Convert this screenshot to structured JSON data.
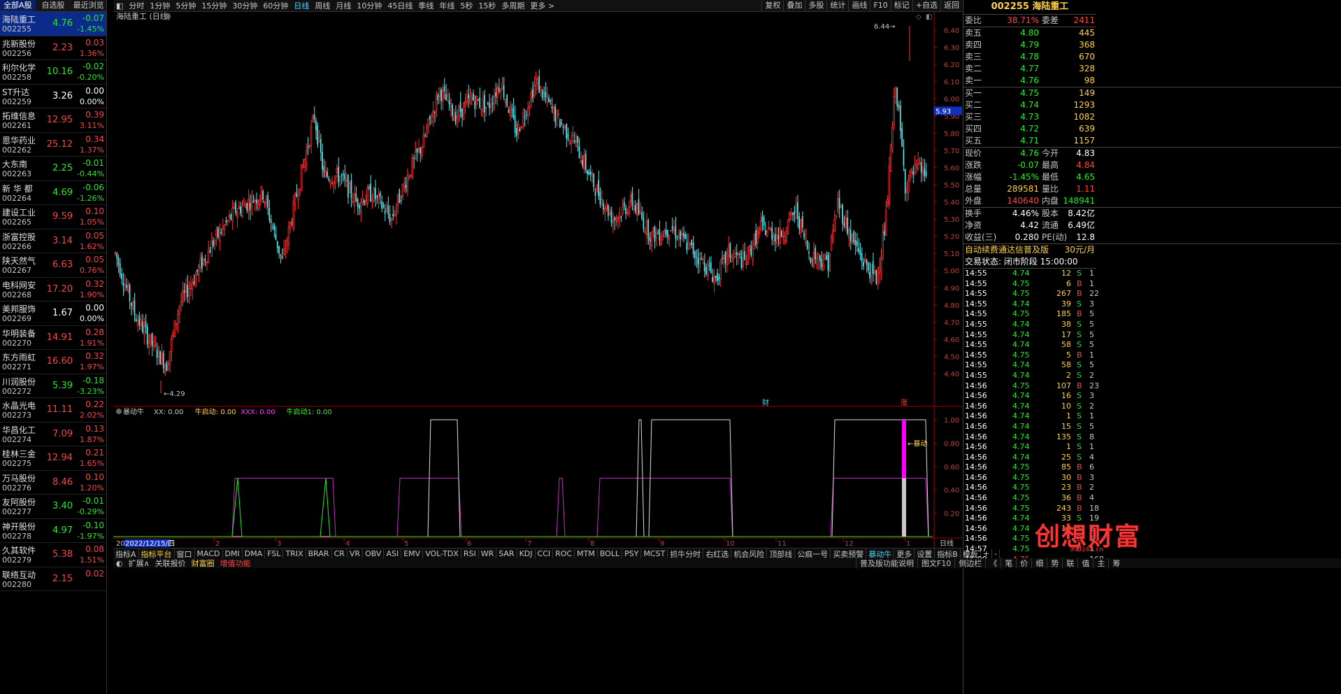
{
  "list_tabs": [
    "全部A股",
    "自选股",
    "最近浏览"
  ],
  "stocks": [
    {
      "name": "海陆重工",
      "code": "002255",
      "price": "4.76",
      "chg": "-0.07",
      "pct": "-1.45%",
      "dir": "dn"
    },
    {
      "name": "兆新股份",
      "code": "002256",
      "price": "2.23",
      "chg": "0.03",
      "pct": "1.36%",
      "dir": "up"
    },
    {
      "name": "利尔化学",
      "code": "002258",
      "price": "10.16",
      "chg": "-0.02",
      "pct": "-0.20%",
      "dir": "dn"
    },
    {
      "name": "ST升达",
      "code": "002259",
      "price": "3.26",
      "chg": "0.00",
      "pct": "0.00%",
      "dir": "fl"
    },
    {
      "name": "拓维信息",
      "code": "002261",
      "price": "12.95",
      "chg": "0.39",
      "pct": "3.11%",
      "dir": "up"
    },
    {
      "name": "恩华药业",
      "code": "002262",
      "price": "25.12",
      "chg": "0.34",
      "pct": "1.37%",
      "dir": "up"
    },
    {
      "name": "大东南",
      "code": "002263",
      "price": "2.25",
      "chg": "-0.01",
      "pct": "-0.44%",
      "dir": "dn"
    },
    {
      "name": "新 华 都",
      "code": "002264",
      "price": "4.69",
      "chg": "-0.06",
      "pct": "-1.26%",
      "dir": "dn"
    },
    {
      "name": "建设工业",
      "code": "002265",
      "price": "9.59",
      "chg": "0.10",
      "pct": "1.05%",
      "dir": "up"
    },
    {
      "name": "浙富控股",
      "code": "002266",
      "price": "3.14",
      "chg": "0.05",
      "pct": "1.62%",
      "dir": "up"
    },
    {
      "name": "陕天然气",
      "code": "002267",
      "price": "6.63",
      "chg": "0.05",
      "pct": "0.76%",
      "dir": "up"
    },
    {
      "name": "电科网安",
      "code": "002268",
      "price": "17.20",
      "chg": "0.32",
      "pct": "1.90%",
      "dir": "up"
    },
    {
      "name": "美邦服饰",
      "code": "002269",
      "price": "1.67",
      "chg": "0.00",
      "pct": "0.00%",
      "dir": "fl"
    },
    {
      "name": "华明装备",
      "code": "002270",
      "price": "14.91",
      "chg": "0.28",
      "pct": "1.91%",
      "dir": "up"
    },
    {
      "name": "东方雨虹",
      "code": "002271",
      "price": "16.60",
      "chg": "0.32",
      "pct": "1.97%",
      "dir": "up"
    },
    {
      "name": "川润股份",
      "code": "002272",
      "price": "5.39",
      "chg": "-0.18",
      "pct": "-3.23%",
      "dir": "dn"
    },
    {
      "name": "水晶光电",
      "code": "002273",
      "price": "11.11",
      "chg": "0.22",
      "pct": "2.02%",
      "dir": "up"
    },
    {
      "name": "华昌化工",
      "code": "002274",
      "price": "7.09",
      "chg": "0.13",
      "pct": "1.87%",
      "dir": "up"
    },
    {
      "name": "桂林三金",
      "code": "002275",
      "price": "12.94",
      "chg": "0.21",
      "pct": "1.65%",
      "dir": "up"
    },
    {
      "name": "万马股份",
      "code": "002276",
      "price": "8.46",
      "chg": "0.10",
      "pct": "1.20%",
      "dir": "up"
    },
    {
      "name": "友阿股份",
      "code": "002277",
      "price": "3.40",
      "chg": "-0.01",
      "pct": "-0.29%",
      "dir": "dn"
    },
    {
      "name": "神开股份",
      "code": "002278",
      "price": "4.97",
      "chg": "-0.10",
      "pct": "-1.97%",
      "dir": "dn"
    },
    {
      "name": "久其软件",
      "code": "002279",
      "price": "5.38",
      "chg": "0.08",
      "pct": "1.51%",
      "dir": "up"
    },
    {
      "name": "联络互动",
      "code": "002280",
      "price": "2.15",
      "chg": "0.02",
      "pct": "",
      "dir": "up"
    }
  ],
  "periods": [
    "分时",
    "1分钟",
    "5分钟",
    "15分钟",
    "30分钟",
    "60分钟",
    "日线",
    "周线",
    "月线",
    "10分钟",
    "45日线",
    "季线",
    "年线",
    "5秒",
    "15秒",
    "多周期",
    "更多 >"
  ],
  "active_period": "日线",
  "right_tools": [
    "复权",
    "叠加",
    "多股",
    "统计",
    "画线",
    "F10",
    "标记",
    "+自选",
    "返回"
  ],
  "chart": {
    "title": "海陆重工 (日线)",
    "price_axis": [
      "6.40",
      "6.30",
      "6.20",
      "6.10",
      "6.00",
      "5.90",
      "5.80",
      "5.70",
      "5.60",
      "5.50",
      "5.40",
      "5.30",
      "5.20",
      "5.10",
      "5.00",
      "4.90",
      "4.80",
      "4.70",
      "4.60",
      "4.50",
      "4.40"
    ],
    "current_price_tag": "5.93",
    "high_label": "6.44",
    "low_label": "4.29",
    "marker_cai": "财",
    "marker_zhang": "涨",
    "indicator_header": [
      {
        "text": "暴动牛",
        "color": "#c8c8c8"
      },
      {
        "text": "XX: 0.00",
        "color": "#c8c8c8"
      },
      {
        "text": "牛启动: 0.00",
        "color": "#ffd24a"
      },
      {
        "text": "XXX: 0.00",
        "color": "#ff33ff"
      },
      {
        "text": "牛启动1: 0.00",
        "color": "#33ee33"
      }
    ],
    "ind_axis": [
      "1.00",
      "0.80",
      "0.60",
      "0.40",
      "0.20"
    ],
    "baodong_label": "暴动",
    "date_label": "2022/12/15/四",
    "month_labels": [
      "2",
      "3",
      "4",
      "5",
      "6",
      "7",
      "8",
      "9",
      "10",
      "11",
      "12",
      "1"
    ],
    "period_label": "日线"
  },
  "chart_data": {
    "type": "candlestick",
    "title": "海陆重工 (日线)",
    "ylim": [
      4.29,
      6.44
    ],
    "high": 6.44,
    "low": 4.29,
    "marked_price": 5.93
  },
  "indicator_tabs": [
    "指标A",
    "指标平台",
    "窗口",
    "MACD",
    "DMI",
    "DMA",
    "FSL",
    "TRIX",
    "BRAR",
    "CR",
    "VR",
    "OBV",
    "ASI",
    "EMV",
    "VOL-TDX",
    "RSI",
    "WR",
    "SAR",
    "KDJ",
    "CCI",
    "ROC",
    "MTM",
    "BOLL",
    "PSY",
    "MCST",
    "抓牛分时",
    "右红选",
    "机会风险",
    "顶部线",
    "公痲一号",
    "买卖预警",
    "暴动牛",
    "更多",
    "设置"
  ],
  "indicator_right": [
    "指标B",
    "模板",
    "+",
    "-"
  ],
  "bottom_bar": [
    "扩展∧",
    "关联报价",
    "财富圈",
    "增值功能"
  ],
  "bottom_right": [
    "普及版功能说明",
    "图文F10",
    "侧边栏",
    "《",
    "笔",
    "价",
    "细",
    "势",
    "联",
    "值",
    "主",
    "筹"
  ],
  "quote": {
    "title": "002255 海陆重工",
    "weibi": {
      "label": "委比",
      "value": "38.71%",
      "label2": "委差",
      "value2": "2411"
    },
    "asks": [
      {
        "label": "卖五",
        "price": "4.80",
        "vol": "445"
      },
      {
        "label": "卖四",
        "price": "4.79",
        "vol": "368"
      },
      {
        "label": "卖三",
        "price": "4.78",
        "vol": "670"
      },
      {
        "label": "卖二",
        "price": "4.77",
        "vol": "328"
      },
      {
        "label": "卖一",
        "price": "4.76",
        "vol": "98"
      }
    ],
    "bids": [
      {
        "label": "买一",
        "price": "4.75",
        "vol": "149"
      },
      {
        "label": "买二",
        "price": "4.74",
        "vol": "1293"
      },
      {
        "label": "买三",
        "price": "4.73",
        "vol": "1082"
      },
      {
        "label": "买四",
        "price": "4.72",
        "vol": "639"
      },
      {
        "label": "买五",
        "price": "4.71",
        "vol": "1157"
      }
    ],
    "stats": [
      {
        "l1": "现价",
        "v1": "4.76",
        "c1": "dn",
        "l2": "今开",
        "v2": "4.83",
        "c2": "fl"
      },
      {
        "l1": "涨跌",
        "v1": "-0.07",
        "c1": "dn",
        "l2": "最高",
        "v2": "4.84",
        "c2": "up"
      },
      {
        "l1": "涨幅",
        "v1": "-1.45%",
        "c1": "dn",
        "l2": "最低",
        "v2": "4.65",
        "c2": "dn"
      },
      {
        "l1": "总量",
        "v1": "289581",
        "c1": "yel",
        "l2": "量比",
        "v2": "1.11",
        "c2": "up"
      },
      {
        "l1": "外盘",
        "v1": "140640",
        "c1": "up",
        "l2": "内盘",
        "v2": "148941",
        "c2": "dn"
      }
    ],
    "stats2": [
      {
        "l1": "换手",
        "v1": "4.46%",
        "l2": "股本",
        "v2": "8.42亿"
      },
      {
        "l1": "净资",
        "v1": "4.42",
        "l2": "流通",
        "v2": "6.49亿"
      },
      {
        "l1": "收益(三)",
        "v1": "0.280",
        "l2": "PE(动)",
        "v2": "12.8"
      }
    ],
    "promo": "自动续费通达信普及版",
    "promo_price": "30元/月",
    "trade_status": "交易状态: 闭市阶段 15:00:00",
    "ticks": [
      {
        "t": "14:55",
        "p": "4.74",
        "v": "12",
        "s": "S",
        "n": "1"
      },
      {
        "t": "14:55",
        "p": "4.75",
        "v": "6",
        "s": "B",
        "n": "1"
      },
      {
        "t": "14:55",
        "p": "4.75",
        "v": "267",
        "s": "B",
        "n": "22"
      },
      {
        "t": "14:55",
        "p": "4.74",
        "v": "39",
        "s": "S",
        "n": "3"
      },
      {
        "t": "14:55",
        "p": "4.75",
        "v": "185",
        "s": "B",
        "n": "5"
      },
      {
        "t": "14:55",
        "p": "4.74",
        "v": "38",
        "s": "S",
        "n": "5"
      },
      {
        "t": "14:55",
        "p": "4.74",
        "v": "17",
        "s": "S",
        "n": "5"
      },
      {
        "t": "14:55",
        "p": "4.74",
        "v": "58",
        "s": "S",
        "n": "5"
      },
      {
        "t": "14:55",
        "p": "4.75",
        "v": "5",
        "s": "B",
        "n": "1"
      },
      {
        "t": "14:55",
        "p": "4.74",
        "v": "58",
        "s": "S",
        "n": "5"
      },
      {
        "t": "14:55",
        "p": "4.74",
        "v": "2",
        "s": "S",
        "n": "2"
      },
      {
        "t": "14:56",
        "p": "4.75",
        "v": "107",
        "s": "B",
        "n": "23"
      },
      {
        "t": "14:56",
        "p": "4.74",
        "v": "16",
        "s": "S",
        "n": "3"
      },
      {
        "t": "14:56",
        "p": "4.74",
        "v": "10",
        "s": "S",
        "n": "2"
      },
      {
        "t": "14:56",
        "p": "4.74",
        "v": "1",
        "s": "S",
        "n": "1"
      },
      {
        "t": "14:56",
        "p": "4.74",
        "v": "15",
        "s": "S",
        "n": "5"
      },
      {
        "t": "14:56",
        "p": "4.74",
        "v": "135",
        "s": "S",
        "n": "8"
      },
      {
        "t": "14:56",
        "p": "4.74",
        "v": "1",
        "s": "S",
        "n": "1"
      },
      {
        "t": "14:56",
        "p": "4.74",
        "v": "25",
        "s": "S",
        "n": "4"
      },
      {
        "t": "14:56",
        "p": "4.75",
        "v": "85",
        "s": "B",
        "n": "6"
      },
      {
        "t": "14:56",
        "p": "4.75",
        "v": "30",
        "s": "B",
        "n": "3"
      },
      {
        "t": "14:56",
        "p": "4.75",
        "v": "23",
        "s": "B",
        "n": "2"
      },
      {
        "t": "14:56",
        "p": "4.75",
        "v": "36",
        "s": "B",
        "n": "4"
      },
      {
        "t": "14:56",
        "p": "4.75",
        "v": "243",
        "s": "B",
        "n": "18"
      },
      {
        "t": "14:56",
        "p": "4.74",
        "v": "33",
        "s": "S",
        "n": "19"
      },
      {
        "t": "14:56",
        "p": "4.74",
        "v": "12",
        "s": "S",
        "n": "2"
      },
      {
        "t": "14:56",
        "p": "4.75",
        "v": "",
        "s": "B",
        "n": "1"
      },
      {
        "t": "14:57",
        "p": "4.75",
        "v": "",
        "s": "B",
        "n": "1"
      },
      {
        "t": "15:00",
        "p": "4.76",
        "v": "",
        "s": "",
        "n": "168"
      }
    ]
  },
  "watermark": "创想财富",
  "watermark_url": "995168.cn",
  "colors": {
    "up": "#ff4444",
    "down": "#22ee22",
    "accent": "#4fd6ff",
    "yellow": "#ffd24a",
    "magenta": "#ff33ff"
  }
}
